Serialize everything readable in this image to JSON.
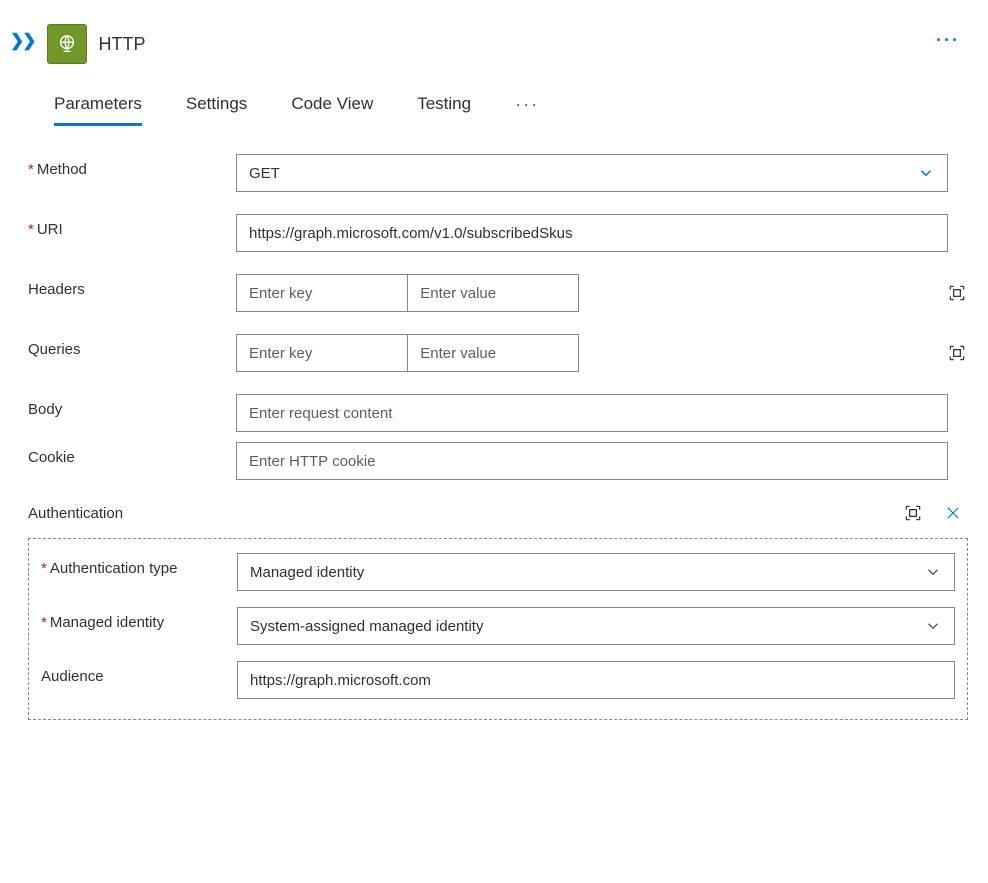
{
  "header": {
    "title": "HTTP"
  },
  "tabs": {
    "items": [
      {
        "label": "Parameters"
      },
      {
        "label": "Settings"
      },
      {
        "label": "Code View"
      },
      {
        "label": "Testing"
      }
    ],
    "activeIndex": 0
  },
  "form": {
    "method": {
      "label": "Method",
      "value": "GET"
    },
    "uri": {
      "label": "URI",
      "value": "https://graph.microsoft.com/v1.0/subscribedSkus"
    },
    "headers": {
      "label": "Headers",
      "keyPlaceholder": "Enter key",
      "valuePlaceholder": "Enter value"
    },
    "queries": {
      "label": "Queries",
      "keyPlaceholder": "Enter key",
      "valuePlaceholder": "Enter value"
    },
    "body": {
      "label": "Body",
      "placeholder": "Enter request content"
    },
    "cookie": {
      "label": "Cookie",
      "placeholder": "Enter HTTP cookie"
    },
    "authentication": {
      "sectionLabel": "Authentication",
      "type": {
        "label": "Authentication type",
        "value": "Managed identity"
      },
      "managedIdentity": {
        "label": "Managed identity",
        "value": "System-assigned managed identity"
      },
      "audience": {
        "label": "Audience",
        "value": "https://graph.microsoft.com"
      }
    }
  }
}
